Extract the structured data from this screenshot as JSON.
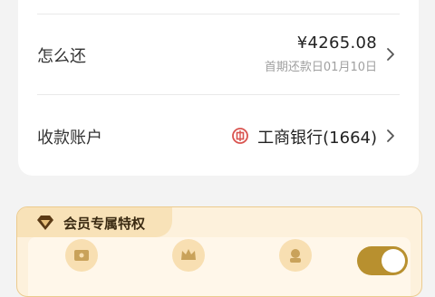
{
  "repay": {
    "label": "怎么还",
    "amount": "¥4265.08",
    "first_due": "首期还款日01月10日"
  },
  "receive_account": {
    "label": "收款账户",
    "bank": "工商银行(1664)",
    "bank_icon": "icbc-logo-icon"
  },
  "member": {
    "title": "会员专属特权",
    "icon": "diamond-icon",
    "perks": [
      "ticket-icon",
      "crown-icon",
      "service-icon"
    ],
    "toggle_on": true
  },
  "colors": {
    "gold": "#b8902f",
    "member_bg": "#fdf1dc",
    "bank_red": "#d9534f"
  }
}
